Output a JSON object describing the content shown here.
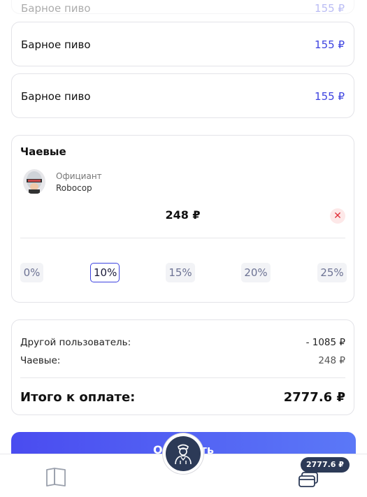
{
  "items": [
    {
      "name": "Барное пиво",
      "price": "155 ₽"
    },
    {
      "name": "Барное пиво",
      "price": "155 ₽"
    },
    {
      "name": "Барное пиво",
      "price": "155 ₽"
    }
  ],
  "tips": {
    "title": "Чаевые",
    "waiter_role": "Официант",
    "waiter_name": "Robocop",
    "amount": "248 ₽",
    "options": [
      "0%",
      "10%",
      "15%",
      "20%",
      "25%"
    ],
    "selected": "10%"
  },
  "summary": {
    "other_user_label": "Другой пользователь:",
    "other_user_value": "- 1085 ₽",
    "tips_label": "Чаевые:",
    "tips_value": "248 ₽",
    "total_label": "Итого к оплате:",
    "total_value": "2777.6 ₽"
  },
  "pay_button_label": "Оплатить",
  "tabbar": {
    "cart_badge": "2777.6 ₽"
  },
  "colors": {
    "accent": "#3d43e0",
    "dark": "#2c3a57"
  }
}
